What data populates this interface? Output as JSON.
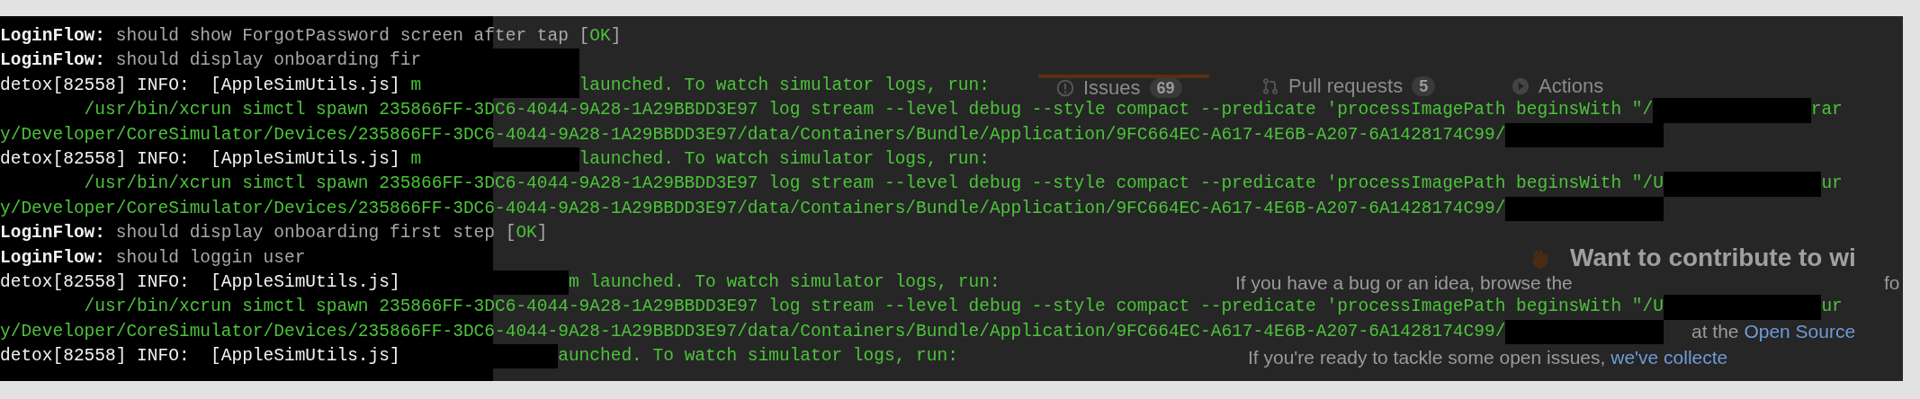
{
  "terminal": {
    "lines": [
      [
        {
          "kind": "label",
          "text": "LoginFlow:"
        },
        {
          "kind": "message",
          "text": " should show ForgotPassword screen after tap ["
        },
        {
          "kind": "ok",
          "text": "OK"
        },
        {
          "kind": "message",
          "text": "]"
        }
      ],
      [
        {
          "kind": "label",
          "text": "LoginFlow:"
        },
        {
          "kind": "message",
          "text": " should display onboarding fir"
        },
        {
          "kind": "redaction"
        }
      ],
      [
        {
          "kind": "info",
          "text": "detox[82558] INFO:  [AppleSimUtils.js] "
        },
        {
          "kind": "green",
          "text": "m"
        },
        {
          "kind": "redaction"
        },
        {
          "kind": "green",
          "text": "launched. To watch simulator logs, run:"
        }
      ],
      [
        {
          "kind": "green",
          "text": "        /usr/bin/xcrun simctl spawn 235866FF-3DC6-4044-9A28-1A29BBDD3E97 log stream --level debug --style compact --predicate 'processImagePath beginsWith \"/"
        },
        {
          "kind": "redaction"
        },
        {
          "kind": "green",
          "text": "rar"
        }
      ],
      [
        {
          "kind": "green",
          "text": "y/Developer/CoreSimulator/Devices/235866FF-3DC6-4044-9A28-1A29BBDD3E97/data/Containers/Bundle/Application/9FC664EC-A617-4E6B-A207-6A1428174C99/"
        },
        {
          "kind": "redaction"
        }
      ],
      [
        {
          "kind": "info",
          "text": "detox[82558] INFO:  [AppleSimUtils.js] "
        },
        {
          "kind": "green",
          "text": "m"
        },
        {
          "kind": "redaction"
        },
        {
          "kind": "green",
          "text": "launched. To watch simulator logs, run:"
        }
      ],
      [
        {
          "kind": "green",
          "text": "        /usr/bin/xcrun simctl spawn 235866FF-3DC6-4044-9A28-1A29BBDD3E97 log stream --level debug --style compact --predicate 'processImagePath beginsWith \"/U"
        },
        {
          "kind": "redaction"
        },
        {
          "kind": "green",
          "text": "ur"
        }
      ],
      [
        {
          "kind": "green",
          "text": "y/Developer/CoreSimulator/Devices/235866FF-3DC6-4044-9A28-1A29BBDD3E97/data/Containers/Bundle/Application/9FC664EC-A617-4E6B-A207-6A1428174C99/"
        },
        {
          "kind": "redaction"
        }
      ],
      [
        {
          "kind": "label",
          "text": "LoginFlow:"
        },
        {
          "kind": "message",
          "text": " should display onboarding first step ["
        },
        {
          "kind": "ok",
          "text": "OK"
        },
        {
          "kind": "message",
          "text": "]"
        }
      ],
      [
        {
          "kind": "label",
          "text": "LoginFlow:"
        },
        {
          "kind": "message",
          "text": " should loggin user"
        }
      ],
      [
        {
          "kind": "info",
          "text": "detox[82558] INFO:  [AppleSimUtils.js] "
        },
        {
          "kind": "redaction"
        },
        {
          "kind": "green",
          "text": "m launched. To watch simulator logs, run:"
        }
      ],
      [
        {
          "kind": "green",
          "text": "        /usr/bin/xcrun simctl spawn 235866FF-3DC6-4044-9A28-1A29BBDD3E97 log stream --level debug --style compact --predicate 'processImagePath beginsWith \"/U"
        },
        {
          "kind": "redaction"
        },
        {
          "kind": "green",
          "text": "ur"
        }
      ],
      [
        {
          "kind": "green",
          "text": "y/Developer/CoreSimulator/Devices/235866FF-3DC6-4044-9A28-1A29BBDD3E97/data/Containers/Bundle/Application/9FC664EC-A617-4E6B-A207-6A1428174C99/"
        },
        {
          "kind": "redaction"
        }
      ],
      [
        {
          "kind": "info",
          "text": "detox[82558] INFO:  [AppleSimUtils.js]"
        },
        {
          "kind": "redaction"
        },
        {
          "kind": "green",
          "text": "aunched. To watch simulator logs, run:"
        }
      ]
    ]
  },
  "background_page": {
    "tabs": [
      {
        "label": "Issues",
        "count": "69",
        "selected": true
      },
      {
        "label": "Pull requests",
        "count": "5",
        "selected": false
      },
      {
        "label": "Actions",
        "selected": false
      }
    ],
    "heading": "Want to contribute to wi",
    "paragraph_1": "If you have a bug or an idea, browse the",
    "paragraph_1_end": "fo",
    "paragraph_2": {
      "text": "at the ",
      "link": "Open Source"
    },
    "paragraph_3": {
      "text": "If you're ready to tackle some open issues, ",
      "link": "we've collecte"
    }
  }
}
